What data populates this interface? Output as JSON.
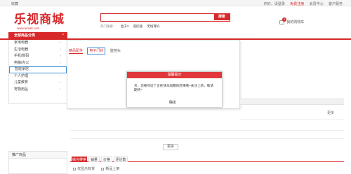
{
  "topbar": {
    "favorite": "收藏",
    "links": [
      "你好，请登录",
      "免费注册",
      "会员中心",
      "客户服务"
    ]
  },
  "logo": {
    "main": "乐视商城",
    "sub": "www.lemall.com"
  },
  "search": {
    "placeholder": "",
    "button": "搜索"
  },
  "hot": {
    "label": "热门搜索：",
    "items": [
      "盒子3",
      "遥控器",
      "无线耳机"
    ]
  },
  "cart": {
    "count": "0",
    "label": "我的购物车"
  },
  "categories": {
    "header": "全部商品分类",
    "items": [
      "家用电器",
      "生活电器",
      "手机/数码",
      "电脑/办公",
      "智能家居",
      "个人护理",
      "儿童教育",
      "宠物用品"
    ]
  },
  "subpanel": {
    "tabs": [
      "精品配件",
      "电子门铃",
      "监控头"
    ]
  },
  "modal": {
    "title": "温馨提示",
    "message": "亲，您要的这个正在快马加鞭的赶来哦~关注上新，敬请期待~",
    "ok": "确定"
  },
  "more_label": "更多",
  "more_button": "更多",
  "sidebar_bottom": {
    "title": "推广商品"
  },
  "sort": {
    "buttons": [
      "综合排序",
      "销量",
      "价格",
      "评论数"
    ]
  },
  "filters": [
    "仅显示有货",
    "新品上架"
  ],
  "colors": {
    "brand": "#d7282a",
    "highlight": "#3a8fd9"
  }
}
